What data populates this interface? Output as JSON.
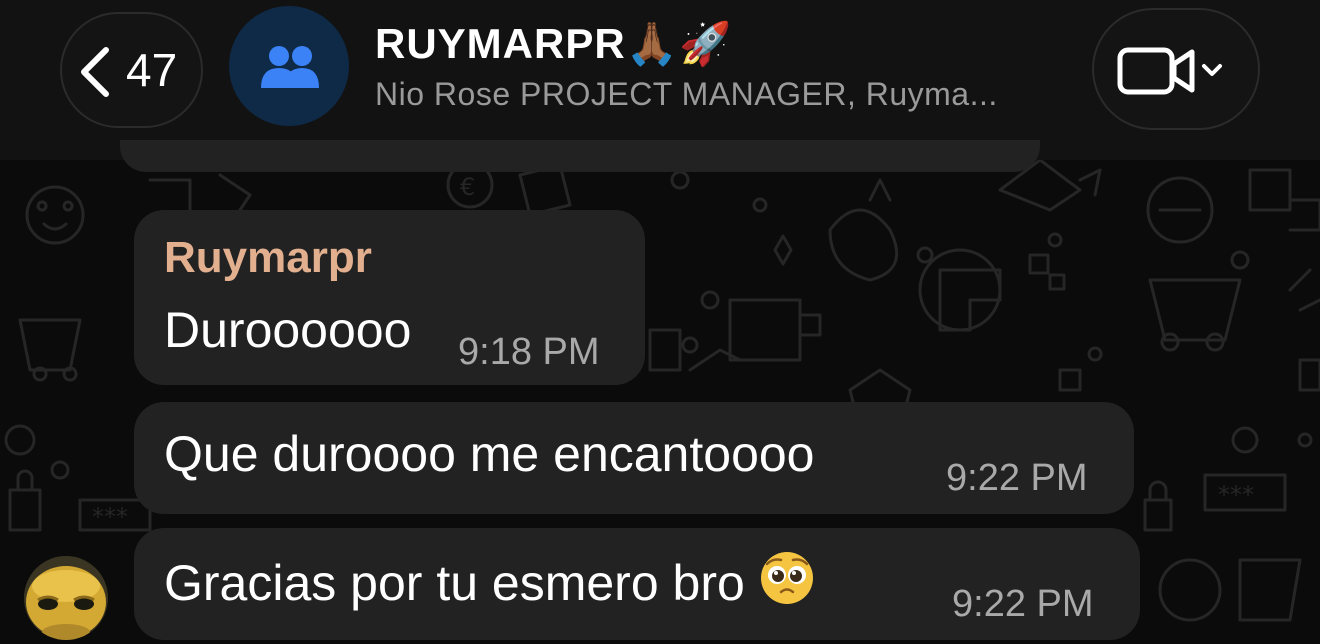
{
  "header": {
    "back_count": "47",
    "title": "RUYMARPR🙏🏾🚀",
    "subtitle": "Nio Rose PROJECT MANAGER, Ruyma...",
    "accent_color": "#3b82f6"
  },
  "icons": {
    "back": "chevron-left-icon",
    "group": "group-people-icon",
    "video": "video-camera-icon",
    "dropdown": "chevron-down-icon"
  },
  "messages": [
    {
      "sender": "Ruymarpr",
      "text": "Duroooooo",
      "time": "9:18 PM"
    },
    {
      "text": "Que duroooo me encantoooo",
      "time": "9:22 PM"
    },
    {
      "text": "Gracias por tu esmero bro",
      "emoji": "🥹",
      "time": "9:22 PM"
    }
  ],
  "colors": {
    "background": "#0b0b0b",
    "bubble": "#222222",
    "sender_name": "#e3b08f",
    "timestamp": "#a9a9a9"
  }
}
